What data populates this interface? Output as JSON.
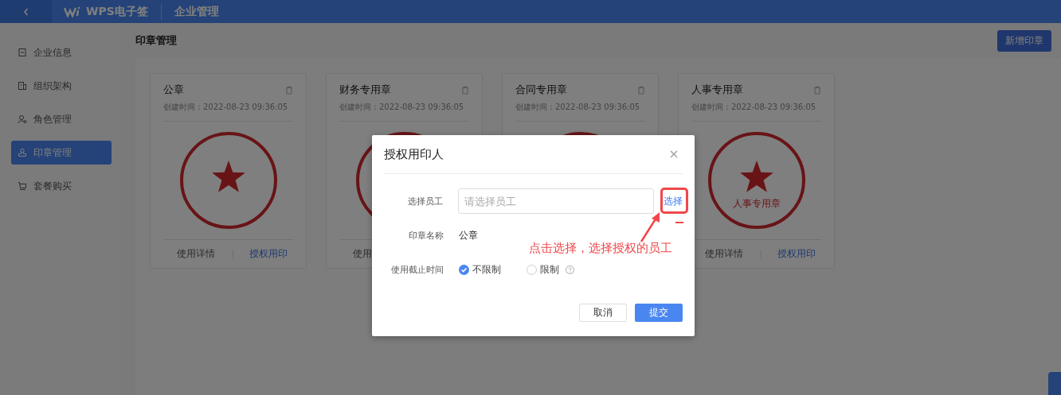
{
  "header": {
    "logo": "WPS电子签",
    "title": "企业管理"
  },
  "sidebar": {
    "items": [
      {
        "label": "企业信息",
        "selected": false
      },
      {
        "label": "组织架构",
        "selected": false
      },
      {
        "label": "角色管理",
        "selected": false
      },
      {
        "label": "印章管理",
        "selected": true
      },
      {
        "label": "套餐购买",
        "selected": false
      }
    ]
  },
  "page": {
    "title": "印章管理",
    "add_button": "新增印章"
  },
  "seals": [
    {
      "name": "公章",
      "created": "创建时间：2022-08-23 09:36:05",
      "actions": [
        "使用详情",
        "授权用印"
      ]
    },
    {
      "name": "财务专用章",
      "created": "创建时间：2022-08-23 09:36:05",
      "actions": [
        "使用"
      ]
    },
    {
      "name": "合同专用章",
      "created": "创建时间：2022-08-23 09:36:05"
    },
    {
      "name": "人事专用章",
      "created": "创建时间：2022-08-23 09:36:05",
      "stamp_label": "人事专用章",
      "actions": [
        "使用详情",
        "授权用印"
      ]
    }
  ],
  "modal": {
    "title": "授权用印人",
    "employee": {
      "label": "选择员工",
      "placeholder": "请选择员工",
      "link": "选择"
    },
    "seal_name": {
      "label": "印章名称",
      "value": "公章"
    },
    "deadline": {
      "label": "使用截止时间",
      "options": [
        {
          "label": "不限制",
          "selected": true
        },
        {
          "label": "限制",
          "selected": false,
          "help": true
        }
      ]
    },
    "buttons": [
      {
        "label": "取消",
        "kind": "default"
      },
      {
        "label": "提交",
        "kind": "primary"
      }
    ]
  },
  "annotation": {
    "text": "点击选择，选择授权的员工"
  }
}
